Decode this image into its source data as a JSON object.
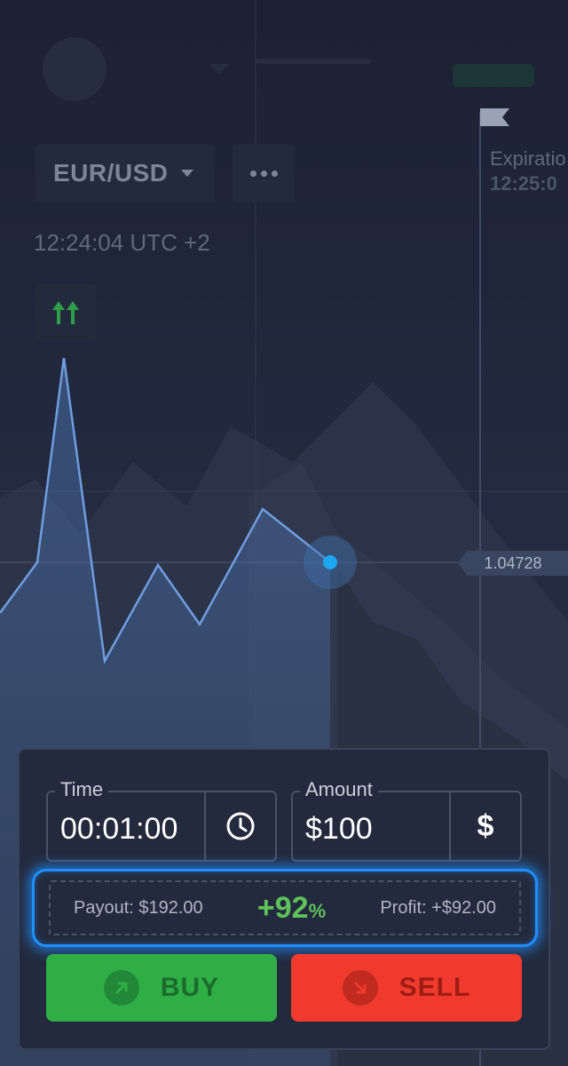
{
  "header": {
    "pair": "EUR/USD",
    "clock": "12:24:04 UTC +2",
    "expiration_label": "Expiratio",
    "expiration_time": "12:25:0"
  },
  "chart": {
    "current_price": "1.04728",
    "trend": "up"
  },
  "trade_panel": {
    "time": {
      "label": "Time",
      "value": "00:01:00"
    },
    "amount": {
      "label": "Amount",
      "value": "$100",
      "currency_symbol": "$"
    },
    "payout": {
      "payout_text": "Payout: $192.00",
      "percent": "+92",
      "percent_sign": "%",
      "profit_text": "Profit: +$92.00"
    },
    "buy_label": "BUY",
    "sell_label": "SELL"
  },
  "colors": {
    "buy": "#2fae46",
    "sell": "#f03a2e",
    "highlight": "#1f8fff",
    "payout_green": "#5ec15a"
  }
}
